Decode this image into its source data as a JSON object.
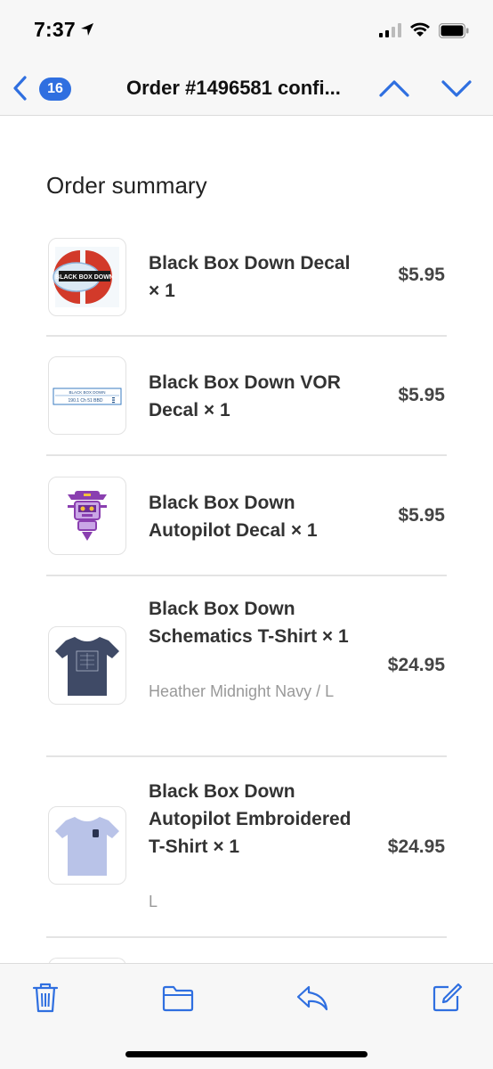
{
  "status_bar": {
    "time": "7:37"
  },
  "nav": {
    "unread_count": "16",
    "title": "Order #1496581 confi..."
  },
  "order": {
    "section_title": "Order summary",
    "items": [
      {
        "name": "Black Box Down Decal × 1",
        "variant": "",
        "price": "$5.95"
      },
      {
        "name": "Black Box Down VOR Decal × 1",
        "variant": "",
        "price": "$5.95"
      },
      {
        "name": "Black Box Down Autopilot Decal × 1",
        "variant": "",
        "price": "$5.95"
      },
      {
        "name": "Black Box Down Schematics T-Shirt × 1",
        "variant": "Heather Midnight Navy / L",
        "price": "$24.95"
      },
      {
        "name": "Black Box Down Autopilot Embroidered T-Shirt × 1",
        "variant": "L",
        "price": "$24.95"
      }
    ],
    "thumb_text": {
      "decal_logo": "BLACK BOX DOWN",
      "vor_top": "BLACK BOX DOWN",
      "vor_bottom": "190.1  Ch 51  BBD"
    }
  },
  "colors": {
    "accent": "#2f6fe0",
    "decal_red": "#d23a2a",
    "decal_blue": "#8fb6dc",
    "autopilot_purple": "#8a3fb0",
    "shirt_navy": "#3f4a66",
    "shirt_lavender": "#b9c3e8"
  },
  "icons": {
    "toolbar": [
      "trash-icon",
      "folder-icon",
      "reply-icon",
      "compose-icon"
    ]
  }
}
